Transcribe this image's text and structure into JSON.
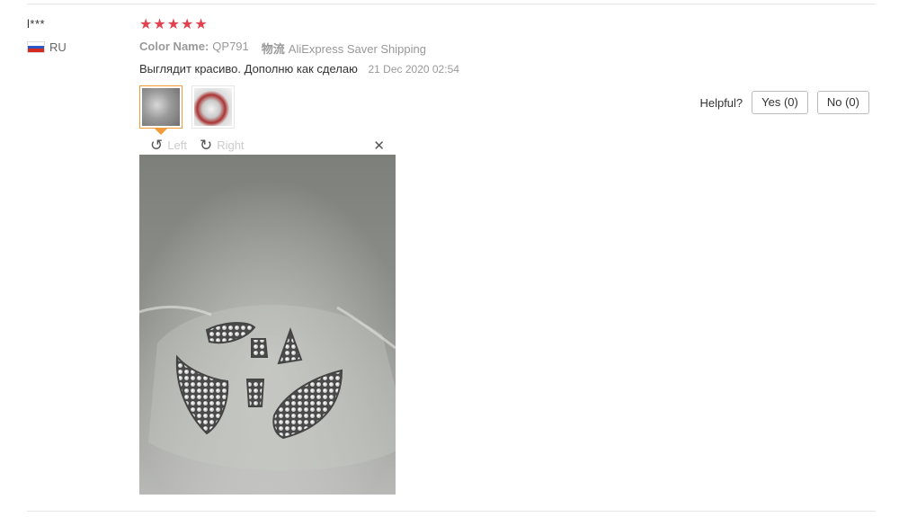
{
  "review": {
    "user_name": "l***",
    "country_code": "RU",
    "rating_stars": 5,
    "star_glyphs": [
      "★",
      "★",
      "★",
      "★",
      "★"
    ],
    "color_label": "Color Name:",
    "color_value": "QP791",
    "shipping_label": "物流",
    "shipping_value": "AliExpress Saver Shipping",
    "feedback_text": "Выглядит красиво. Дополню как сделаю",
    "date": "21 Dec 2020 02:54"
  },
  "viewer": {
    "rotate_left_label": "Left",
    "rotate_right_label": "Right",
    "rotate_left_icon": "↺",
    "rotate_right_icon": "↻",
    "close_icon": "✕"
  },
  "helpful": {
    "label": "Helpful?",
    "yes_label": "Yes (0)",
    "no_label": "No (0)"
  },
  "colors": {
    "star": "#e2424f",
    "active_thumb_border": "#f39a3b"
  }
}
